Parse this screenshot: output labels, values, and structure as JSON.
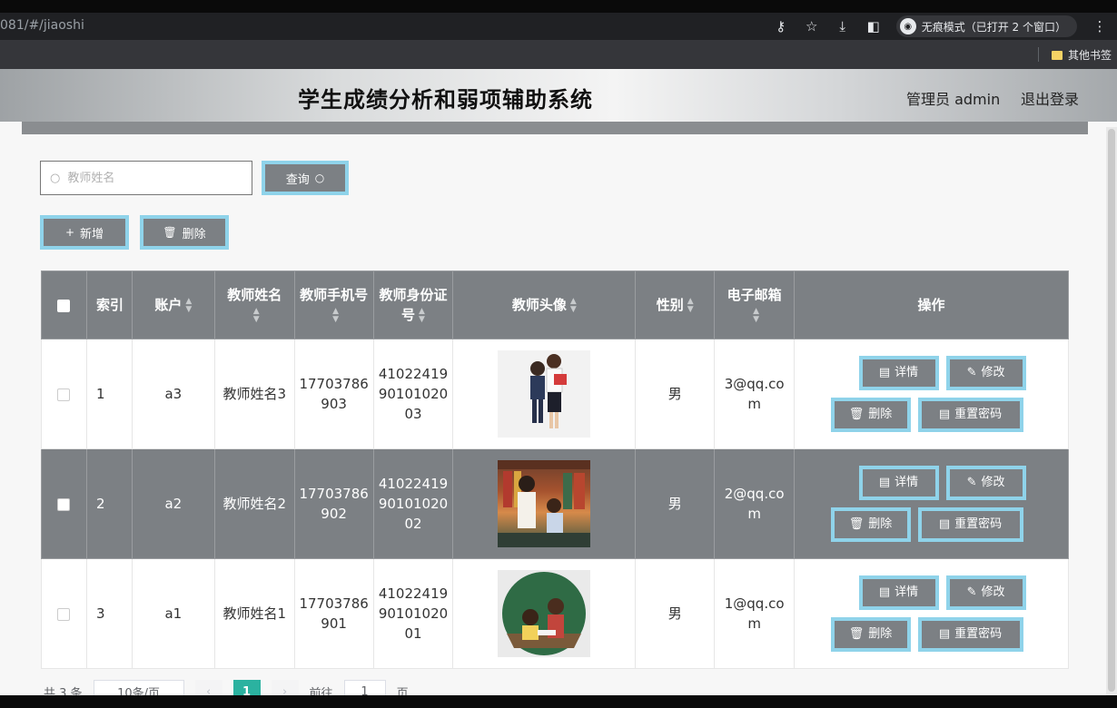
{
  "browser": {
    "url": "081/#/jiaoshi",
    "incognito_label": "无痕模式（已打开 2 个窗口）",
    "bookmark_folder": "其他书签"
  },
  "header": {
    "title": "学生成绩分析和弱项辅助系统",
    "admin": "管理员 admin",
    "logout": "退出登录"
  },
  "search": {
    "placeholder": "教师姓名",
    "query_button": "查询"
  },
  "actions": {
    "add": "新增",
    "delete": "删除"
  },
  "table": {
    "columns": [
      "索引",
      "账户",
      "教师姓名",
      "教师手机号",
      "教师身份证号",
      "教师头像",
      "性别",
      "电子邮箱",
      "操作"
    ],
    "rows": [
      {
        "index": "1",
        "account": "a3",
        "name": "教师姓名3",
        "phone": "17703786903",
        "id_card": "410224199010102003",
        "gender": "男",
        "email": "3@qq.com"
      },
      {
        "index": "2",
        "account": "a2",
        "name": "教师姓名2",
        "phone": "17703786902",
        "id_card": "410224199010102002",
        "gender": "男",
        "email": "2@qq.com"
      },
      {
        "index": "3",
        "account": "a1",
        "name": "教师姓名1",
        "phone": "17703786901",
        "id_card": "410224199010102001",
        "gender": "男",
        "email": "1@qq.com"
      }
    ],
    "row_actions": {
      "detail": "详情",
      "edit": "修改",
      "delete": "删除",
      "reset_password": "重置密码"
    }
  },
  "pagination": {
    "total": "共 3 条",
    "page_size": "10条/页",
    "current_page": "1",
    "goto_label": "前往",
    "goto_value": "1",
    "page_suffix": "页"
  },
  "colors": {
    "header_gray": "#7c8084",
    "button_border": "#8fd3ea",
    "active_page": "#2bb2a0"
  }
}
